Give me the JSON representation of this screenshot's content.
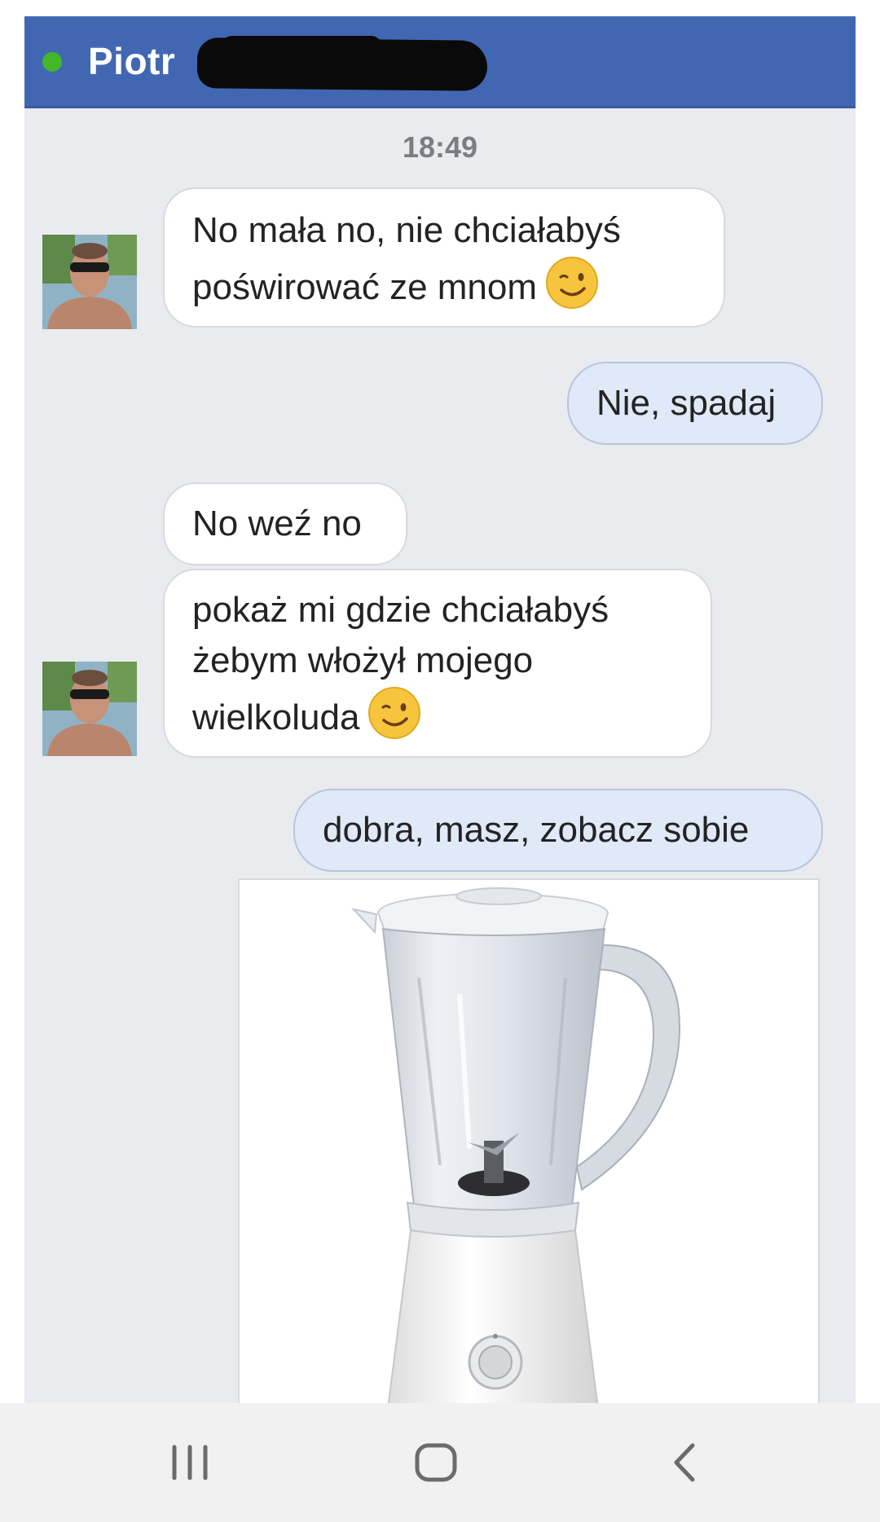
{
  "header": {
    "contact_name": "Piotr",
    "status": "online"
  },
  "conversation": {
    "timestamp": "18:49",
    "messages": [
      {
        "sender": "contact",
        "lines": [
          "No mała no, nie chciałabyś",
          "poświrować ze mnom"
        ],
        "emoji": "wink-emoji"
      },
      {
        "sender": "me",
        "lines": [
          "Nie, spadaj"
        ]
      },
      {
        "sender": "contact",
        "lines": [
          "No weź no"
        ]
      },
      {
        "sender": "contact",
        "lines": [
          "pokaż mi gdzie chciałabyś",
          "żebym włożył mojego",
          "wielkoluda"
        ],
        "emoji": "wink-emoji"
      },
      {
        "sender": "me",
        "lines": [
          "dobra, masz, zobacz sobie"
        ]
      },
      {
        "sender": "me",
        "attachment": "blender-photo"
      }
    ]
  },
  "navbar": {
    "buttons": [
      "recent-apps-button",
      "home-button",
      "back-button"
    ]
  },
  "colors": {
    "header": "#4267b2",
    "online": "#42b72a",
    "chat_background": "#e9ebee",
    "incoming_bubble": "#ffffff",
    "outgoing_bubble": "#dfe9f7"
  }
}
